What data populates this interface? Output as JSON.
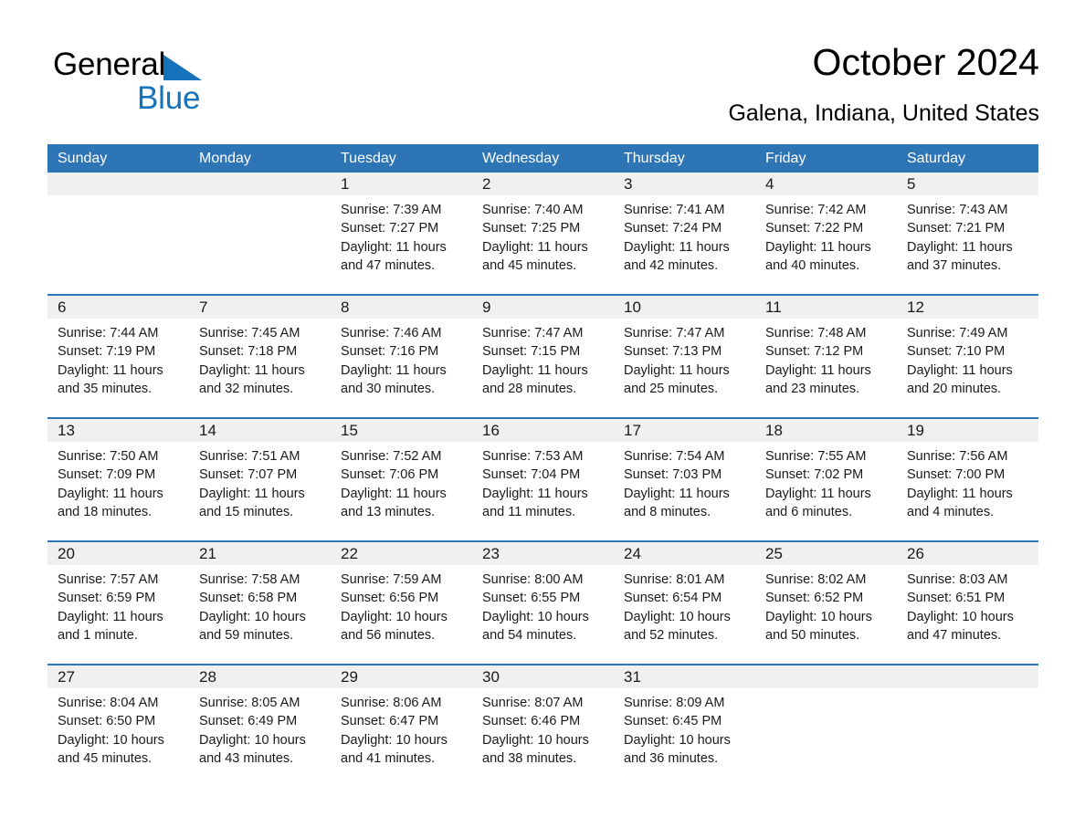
{
  "brand": {
    "name_dark": "General",
    "name_blue": "Blue",
    "triangle_color": "#1473bb",
    "blue": "#1473bb"
  },
  "header": {
    "title": "October 2024",
    "subtitle": "Galena, Indiana, United States"
  },
  "theme": {
    "header_blue": "#2e75b6",
    "row_rule_blue": "#2e75b6",
    "daynum_band": "#f0f0f0",
    "cell_bg": "#ffffff",
    "text": "#1a1a1a"
  },
  "calendar": {
    "weekday_headers": [
      "Sunday",
      "Monday",
      "Tuesday",
      "Wednesday",
      "Thursday",
      "Friday",
      "Saturday"
    ],
    "weeks": [
      [
        {
          "day": "",
          "sunrise": "",
          "sunset": "",
          "daylight": ""
        },
        {
          "day": "",
          "sunrise": "",
          "sunset": "",
          "daylight": ""
        },
        {
          "day": "1",
          "sunrise": "Sunrise: 7:39 AM",
          "sunset": "Sunset: 7:27 PM",
          "daylight": "Daylight: 11 hours and 47 minutes."
        },
        {
          "day": "2",
          "sunrise": "Sunrise: 7:40 AM",
          "sunset": "Sunset: 7:25 PM",
          "daylight": "Daylight: 11 hours and 45 minutes."
        },
        {
          "day": "3",
          "sunrise": "Sunrise: 7:41 AM",
          "sunset": "Sunset: 7:24 PM",
          "daylight": "Daylight: 11 hours and 42 minutes."
        },
        {
          "day": "4",
          "sunrise": "Sunrise: 7:42 AM",
          "sunset": "Sunset: 7:22 PM",
          "daylight": "Daylight: 11 hours and 40 minutes."
        },
        {
          "day": "5",
          "sunrise": "Sunrise: 7:43 AM",
          "sunset": "Sunset: 7:21 PM",
          "daylight": "Daylight: 11 hours and 37 minutes."
        }
      ],
      [
        {
          "day": "6",
          "sunrise": "Sunrise: 7:44 AM",
          "sunset": "Sunset: 7:19 PM",
          "daylight": "Daylight: 11 hours and 35 minutes."
        },
        {
          "day": "7",
          "sunrise": "Sunrise: 7:45 AM",
          "sunset": "Sunset: 7:18 PM",
          "daylight": "Daylight: 11 hours and 32 minutes."
        },
        {
          "day": "8",
          "sunrise": "Sunrise: 7:46 AM",
          "sunset": "Sunset: 7:16 PM",
          "daylight": "Daylight: 11 hours and 30 minutes."
        },
        {
          "day": "9",
          "sunrise": "Sunrise: 7:47 AM",
          "sunset": "Sunset: 7:15 PM",
          "daylight": "Daylight: 11 hours and 28 minutes."
        },
        {
          "day": "10",
          "sunrise": "Sunrise: 7:47 AM",
          "sunset": "Sunset: 7:13 PM",
          "daylight": "Daylight: 11 hours and 25 minutes."
        },
        {
          "day": "11",
          "sunrise": "Sunrise: 7:48 AM",
          "sunset": "Sunset: 7:12 PM",
          "daylight": "Daylight: 11 hours and 23 minutes."
        },
        {
          "day": "12",
          "sunrise": "Sunrise: 7:49 AM",
          "sunset": "Sunset: 7:10 PM",
          "daylight": "Daylight: 11 hours and 20 minutes."
        }
      ],
      [
        {
          "day": "13",
          "sunrise": "Sunrise: 7:50 AM",
          "sunset": "Sunset: 7:09 PM",
          "daylight": "Daylight: 11 hours and 18 minutes."
        },
        {
          "day": "14",
          "sunrise": "Sunrise: 7:51 AM",
          "sunset": "Sunset: 7:07 PM",
          "daylight": "Daylight: 11 hours and 15 minutes."
        },
        {
          "day": "15",
          "sunrise": "Sunrise: 7:52 AM",
          "sunset": "Sunset: 7:06 PM",
          "daylight": "Daylight: 11 hours and 13 minutes."
        },
        {
          "day": "16",
          "sunrise": "Sunrise: 7:53 AM",
          "sunset": "Sunset: 7:04 PM",
          "daylight": "Daylight: 11 hours and 11 minutes."
        },
        {
          "day": "17",
          "sunrise": "Sunrise: 7:54 AM",
          "sunset": "Sunset: 7:03 PM",
          "daylight": "Daylight: 11 hours and 8 minutes."
        },
        {
          "day": "18",
          "sunrise": "Sunrise: 7:55 AM",
          "sunset": "Sunset: 7:02 PM",
          "daylight": "Daylight: 11 hours and 6 minutes."
        },
        {
          "day": "19",
          "sunrise": "Sunrise: 7:56 AM",
          "sunset": "Sunset: 7:00 PM",
          "daylight": "Daylight: 11 hours and 4 minutes."
        }
      ],
      [
        {
          "day": "20",
          "sunrise": "Sunrise: 7:57 AM",
          "sunset": "Sunset: 6:59 PM",
          "daylight": "Daylight: 11 hours and 1 minute."
        },
        {
          "day": "21",
          "sunrise": "Sunrise: 7:58 AM",
          "sunset": "Sunset: 6:58 PM",
          "daylight": "Daylight: 10 hours and 59 minutes."
        },
        {
          "day": "22",
          "sunrise": "Sunrise: 7:59 AM",
          "sunset": "Sunset: 6:56 PM",
          "daylight": "Daylight: 10 hours and 56 minutes."
        },
        {
          "day": "23",
          "sunrise": "Sunrise: 8:00 AM",
          "sunset": "Sunset: 6:55 PM",
          "daylight": "Daylight: 10 hours and 54 minutes."
        },
        {
          "day": "24",
          "sunrise": "Sunrise: 8:01 AM",
          "sunset": "Sunset: 6:54 PM",
          "daylight": "Daylight: 10 hours and 52 minutes."
        },
        {
          "day": "25",
          "sunrise": "Sunrise: 8:02 AM",
          "sunset": "Sunset: 6:52 PM",
          "daylight": "Daylight: 10 hours and 50 minutes."
        },
        {
          "day": "26",
          "sunrise": "Sunrise: 8:03 AM",
          "sunset": "Sunset: 6:51 PM",
          "daylight": "Daylight: 10 hours and 47 minutes."
        }
      ],
      [
        {
          "day": "27",
          "sunrise": "Sunrise: 8:04 AM",
          "sunset": "Sunset: 6:50 PM",
          "daylight": "Daylight: 10 hours and 45 minutes."
        },
        {
          "day": "28",
          "sunrise": "Sunrise: 8:05 AM",
          "sunset": "Sunset: 6:49 PM",
          "daylight": "Daylight: 10 hours and 43 minutes."
        },
        {
          "day": "29",
          "sunrise": "Sunrise: 8:06 AM",
          "sunset": "Sunset: 6:47 PM",
          "daylight": "Daylight: 10 hours and 41 minutes."
        },
        {
          "day": "30",
          "sunrise": "Sunrise: 8:07 AM",
          "sunset": "Sunset: 6:46 PM",
          "daylight": "Daylight: 10 hours and 38 minutes."
        },
        {
          "day": "31",
          "sunrise": "Sunrise: 8:09 AM",
          "sunset": "Sunset: 6:45 PM",
          "daylight": "Daylight: 10 hours and 36 minutes."
        },
        {
          "day": "",
          "sunrise": "",
          "sunset": "",
          "daylight": ""
        },
        {
          "day": "",
          "sunrise": "",
          "sunset": "",
          "daylight": ""
        }
      ]
    ]
  }
}
